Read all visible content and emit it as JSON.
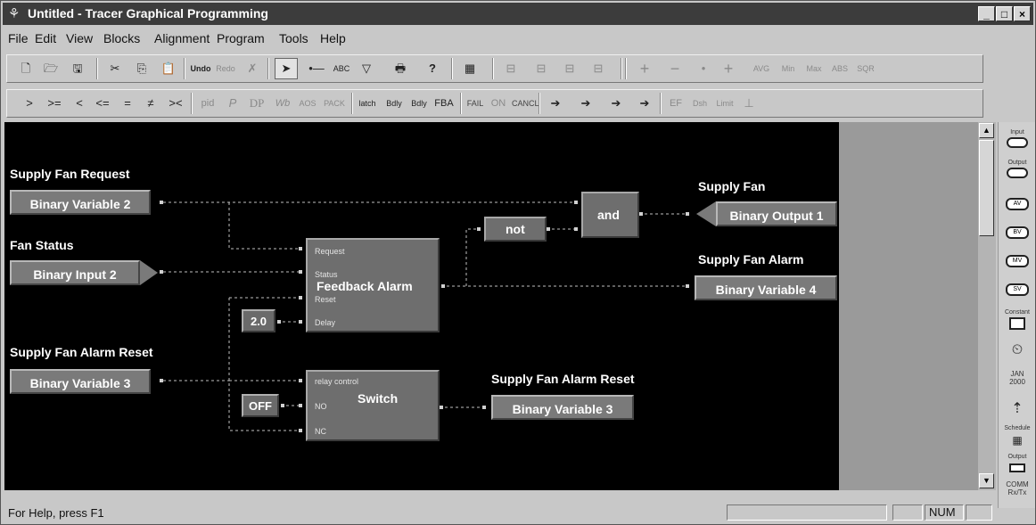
{
  "window": {
    "title": "Untitled - Tracer Graphical Programming",
    "icon": "tracer-app-icon",
    "controls": {
      "minimize": "_",
      "maximize": "□",
      "close": "×"
    }
  },
  "menu": [
    "File",
    "Edit",
    "View",
    "Blocks",
    "Alignment",
    "Program",
    "Tools",
    "Help"
  ],
  "toolbar1": {
    "buttons": [
      "🗋",
      "🗁",
      "🖫",
      "✂",
      "⎘",
      "📋",
      "Undo",
      "Redo",
      "✗",
      "➤",
      "•—",
      "ABC",
      "▽",
      "🖶",
      "?",
      "▦",
      "⊟",
      "⊟",
      "⊟",
      "⊟",
      "+",
      "−",
      "•",
      "+",
      "AVG",
      "Min",
      "Max",
      "ABS",
      "SQR"
    ]
  },
  "toolbar2": {
    "buttons": [
      ">",
      ">=",
      "<",
      "<=",
      "=",
      "≠",
      "><",
      "pid",
      "P",
      "DP",
      "Wb",
      "AOS",
      "PACK",
      "latch",
      "Bdly",
      "Bdly",
      "FBA",
      "FAIL",
      "ON",
      "CANCL",
      "➔",
      "➔",
      "➔",
      "➔",
      "EF",
      "Dsh",
      "Limit",
      "⊥"
    ]
  },
  "diagram": {
    "labels": {
      "supply_fan_request": "Supply Fan Request",
      "fan_status": "Fan Status",
      "supply_fan_alarm_reset_in": "Supply Fan Alarm Reset",
      "supply_fan": "Supply Fan",
      "supply_fan_alarm": "Supply Fan Alarm",
      "supply_fan_alarm_reset_out": "Supply Fan Alarm Reset"
    },
    "variables": {
      "binary_variable_2": "Binary Variable 2",
      "binary_input_2": "Binary Input 2",
      "binary_variable_3_in": "Binary Variable 3",
      "binary_output_1": "Binary Output 1",
      "binary_variable_4": "Binary Variable 4",
      "binary_variable_3_out": "Binary Variable 3"
    },
    "blocks": {
      "not": "not",
      "and": "and",
      "feedback_alarm": {
        "name": "Feedback Alarm",
        "ports": [
          "Request",
          "Status",
          "Reset",
          "Delay"
        ]
      },
      "switch": {
        "name": "Switch",
        "ports": [
          "relay control",
          "NO",
          "NC"
        ]
      }
    },
    "constants": {
      "delay": "2.0",
      "off": "OFF"
    }
  },
  "palette": [
    "Input",
    "Output",
    "AV",
    "BV",
    "MV",
    "SV",
    "Constant",
    "⏲",
    "JAN 2000",
    "⇡",
    "Schedule",
    "Output",
    "COMM Rx/Tx"
  ],
  "status": {
    "help": "For Help, press F1",
    "num": "NUM"
  },
  "colors": {
    "canvas": "#000000",
    "block": "#6e6e6e",
    "wire": "#c8c8c8"
  }
}
